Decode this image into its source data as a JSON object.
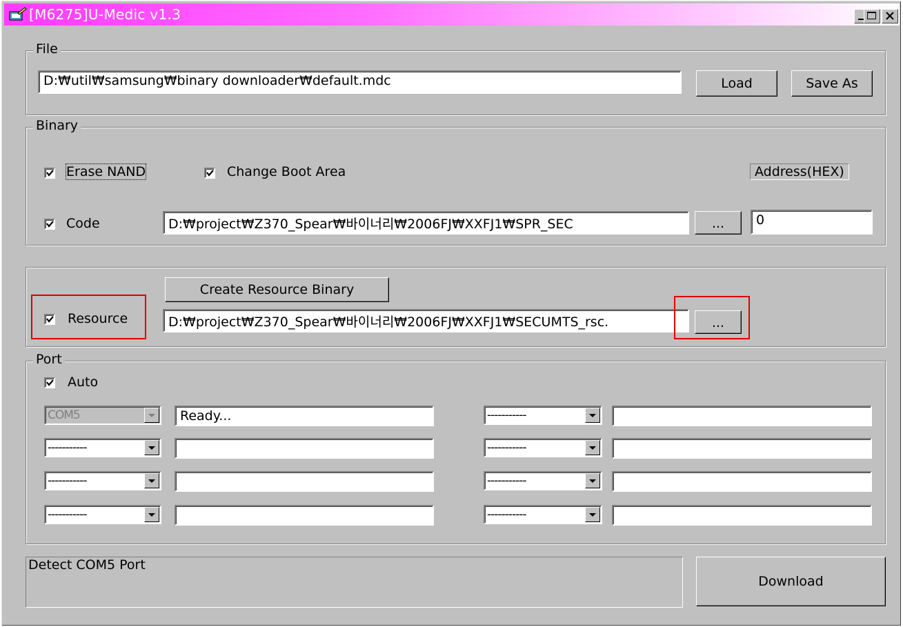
{
  "window": {
    "title": "[M6275]U-Medic v1.3"
  },
  "file": {
    "legend": "File",
    "path": "D:₩util₩samsung₩binary downloader₩default.mdc",
    "load_label": "Load",
    "save_as_label": "Save As"
  },
  "binary": {
    "legend": "Binary",
    "erase_nand": {
      "label": "Erase NAND",
      "checked": true
    },
    "change_boot": {
      "label": "Change Boot Area",
      "checked": true
    },
    "address_label": "Address(HEX)",
    "code": {
      "label": "Code",
      "checked": true,
      "path": "D:₩project₩Z370_Spear₩바이너리₩2006FJ₩XXFJ1₩SPR_SEC",
      "browse_label": "...",
      "address": "0"
    }
  },
  "resource": {
    "create_label": "Create Resource Binary",
    "label": "Resource",
    "checked": true,
    "path": "D:₩project₩Z370_Spear₩바이너리₩2006FJ₩XXFJ1₩SECUMTS_rsc.",
    "browse_label": "..."
  },
  "port": {
    "legend": "Port",
    "auto": {
      "label": "Auto",
      "checked": true
    },
    "rows_left": [
      {
        "combo": "COM5",
        "status": "Ready...",
        "disabled": true
      },
      {
        "combo": "-----------",
        "status": ""
      },
      {
        "combo": "-----------",
        "status": ""
      },
      {
        "combo": "-----------",
        "status": ""
      }
    ],
    "rows_right": [
      {
        "combo": "-----------",
        "status": ""
      },
      {
        "combo": "-----------",
        "status": ""
      },
      {
        "combo": "-----------",
        "status": ""
      },
      {
        "combo": "-----------",
        "status": ""
      }
    ]
  },
  "status_text": "Detect COM5 Port",
  "download_label": "Download",
  "colors": {
    "title_gradient_start": "#ff3cff",
    "highlight": "#e00000",
    "face": "#c0c0c0"
  }
}
